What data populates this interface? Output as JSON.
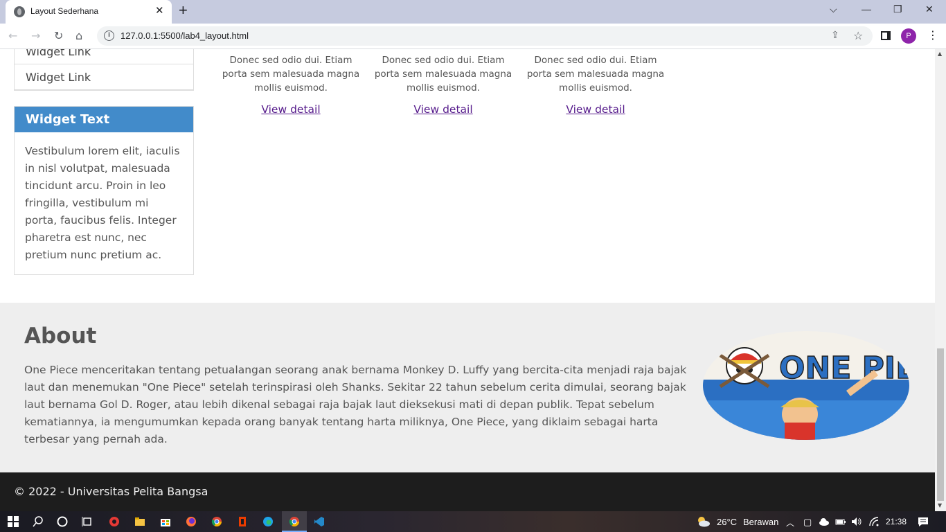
{
  "browser": {
    "tab_title": "Layout Sederhana",
    "tab_close": "✕",
    "new_tab": "+",
    "url": "127.0.0.1:5500/lab4_layout.html",
    "profile_initial": "P",
    "window_controls": {
      "dropdown": "⌵",
      "minimize": "—",
      "restore": "❐",
      "close": "✕"
    }
  },
  "sidebar": {
    "links": [
      "Widget Link",
      "Widget Link"
    ],
    "widget_text": {
      "title": "Widget Text",
      "body": "Vestibulum lorem elit, iaculis in nisl volutpat, malesuada tincidunt arcu. Proin in leo fringilla, vestibulum mi porta, faucibus felis. Integer pharetra est nunc, nec pretium nunc pretium ac."
    }
  },
  "cards": [
    {
      "desc": "Donec sed odio dui. Etiam porta sem malesuada magna mollis euismod.",
      "link": "View detail"
    },
    {
      "desc": "Donec sed odio dui. Etiam porta sem malesuada magna mollis euismod.",
      "link": "View detail"
    },
    {
      "desc": "Donec sed odio dui. Etiam porta sem malesuada magna mollis euismod.",
      "link": "View detail"
    }
  ],
  "about": {
    "title": "About",
    "text": "One Piece menceritakan tentang petualangan seorang anak bernama Monkey D. Luffy yang bercita-cita menjadi raja bajak laut dan menemukan \"One Piece\" setelah terinspirasi oleh Shanks. Sekitar 22 tahun sebelum cerita dimulai, seorang bajak laut bernama Gol D. Roger, atau lebih dikenal sebagai raja bajak laut dieksekusi mati di depan publik. Tepat sebelum kematiannya, ia mengumumkan kepada orang banyak tentang harta miliknya, One Piece, yang diklaim sebagai harta terbesar yang pernah ada.",
    "logo_text": "ONE PIECE"
  },
  "footer": {
    "text": "© 2022 - Universitas Pelita Bangsa"
  },
  "taskbar": {
    "weather_temp": "26°C",
    "weather_desc": "Berawan",
    "time": "21:38"
  },
  "colors": {
    "widget_header": "#428bca",
    "footer_bg": "#1d1d1d",
    "about_bg": "#eeeeee",
    "link": "#551a8b"
  }
}
